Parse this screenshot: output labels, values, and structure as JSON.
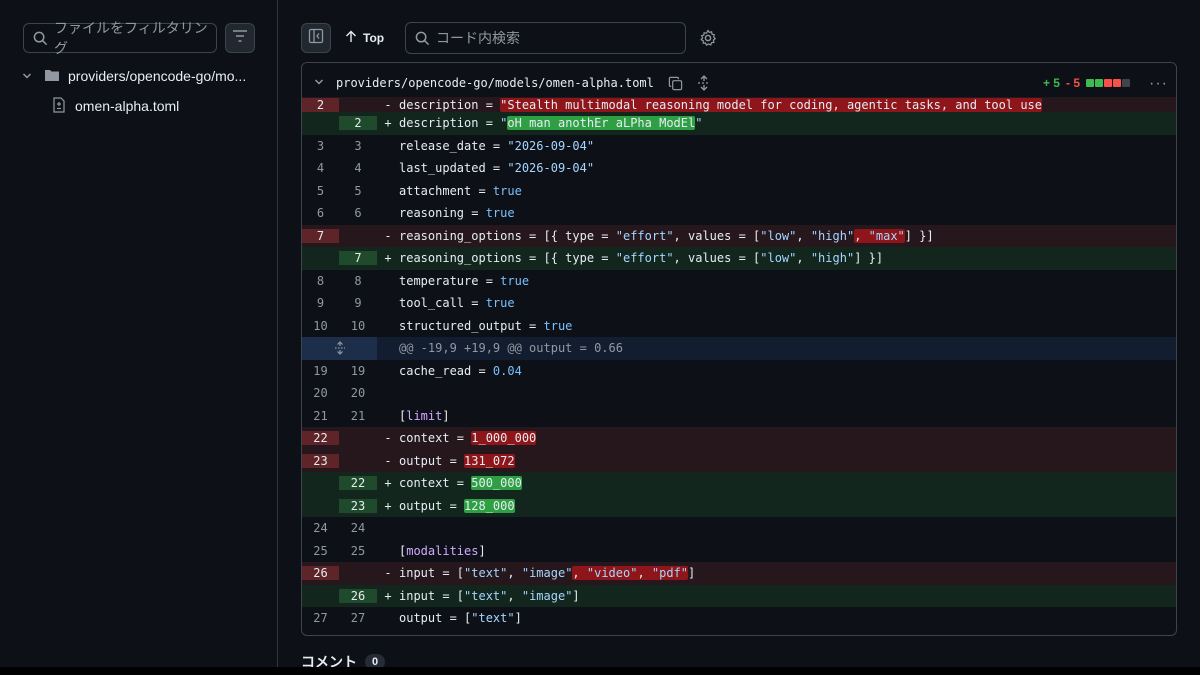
{
  "sidebar": {
    "filter_placeholder": "ファイルをフィルタリング",
    "folder_label": "providers/opencode-go/mo...",
    "file_label": "omen-alpha.toml"
  },
  "toolbar": {
    "top_label": "Top",
    "search_placeholder": "コード内検索"
  },
  "file": {
    "path": "providers/opencode-go/models/omen-alpha.toml",
    "additions": "+ 5",
    "deletions": "- 5",
    "colors": {
      "add": "#3fb950",
      "del": "#f85149",
      "neutral": "#3d444d"
    }
  },
  "comments": {
    "label": "コメント",
    "count": "0"
  }
}
